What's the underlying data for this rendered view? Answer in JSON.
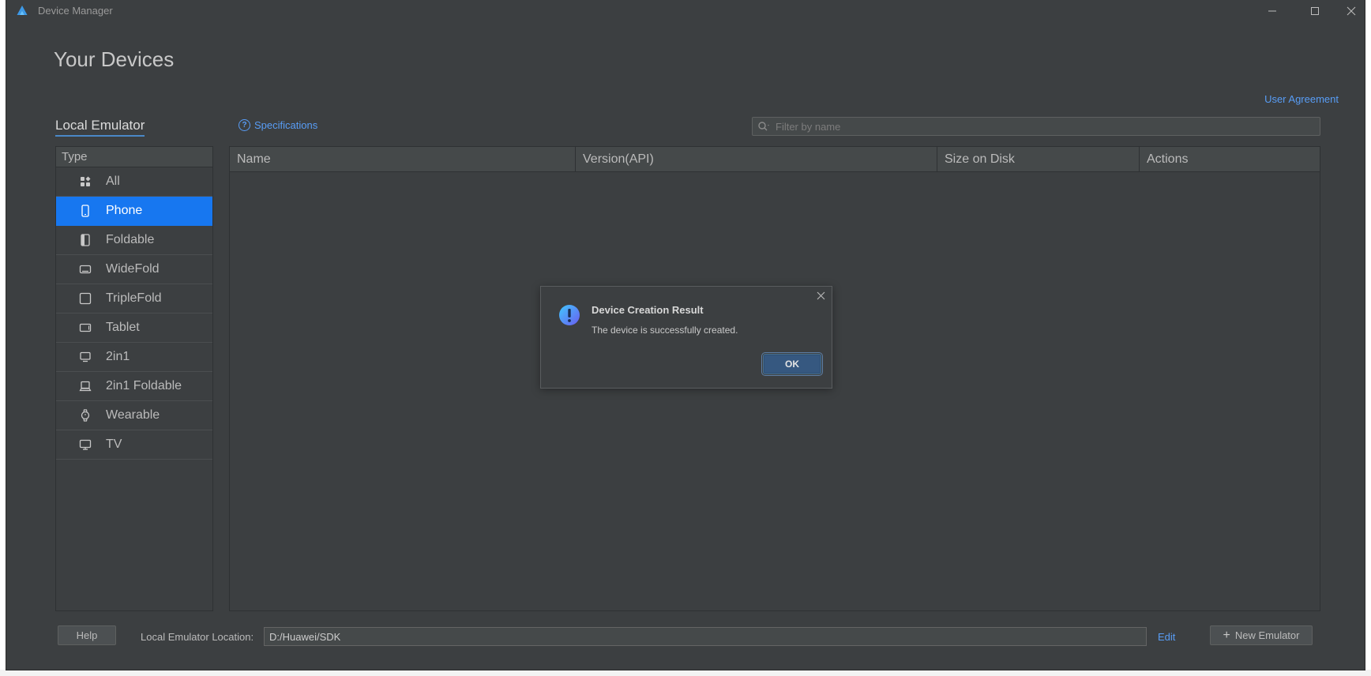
{
  "window": {
    "title": "Device Manager",
    "controls": {
      "minimize": "—",
      "maximize": "☐",
      "close": "✕"
    }
  },
  "page": {
    "title": "Your Devices",
    "user_agreement": "User Agreement"
  },
  "tabs": {
    "local_emulator": "Local Emulator",
    "specifications": "Specifications"
  },
  "search": {
    "placeholder": "Filter by name"
  },
  "sidebar": {
    "header": "Type",
    "items": [
      {
        "label": "All",
        "icon": "grid-icon",
        "selected": false
      },
      {
        "label": "Phone",
        "icon": "phone-icon",
        "selected": true
      },
      {
        "label": "Foldable",
        "icon": "foldable-icon",
        "selected": false
      },
      {
        "label": "WideFold",
        "icon": "widefold-icon",
        "selected": false
      },
      {
        "label": "TripleFold",
        "icon": "triplefold-icon",
        "selected": false
      },
      {
        "label": "Tablet",
        "icon": "tablet-icon",
        "selected": false
      },
      {
        "label": "2in1",
        "icon": "laptop-icon",
        "selected": false
      },
      {
        "label": "2in1 Foldable",
        "icon": "laptop-foldable-icon",
        "selected": false
      },
      {
        "label": "Wearable",
        "icon": "watch-icon",
        "selected": false
      },
      {
        "label": "TV",
        "icon": "tv-icon",
        "selected": false
      }
    ]
  },
  "table": {
    "columns": [
      "Name",
      "Version(API)",
      "Size on Disk",
      "Actions"
    ],
    "rows": []
  },
  "dialog": {
    "title": "Device Creation Result",
    "message": "The device is successfully created.",
    "ok_label": "OK"
  },
  "footer": {
    "help_label": "Help",
    "location_label": "Local Emulator Location:",
    "location_value": "D:/Huawei/SDK",
    "edit_label": "Edit",
    "new_emulator_label": "New Emulator"
  },
  "colors": {
    "accent": "#1777f0",
    "link": "#589df6",
    "background": "#3c3f41"
  }
}
